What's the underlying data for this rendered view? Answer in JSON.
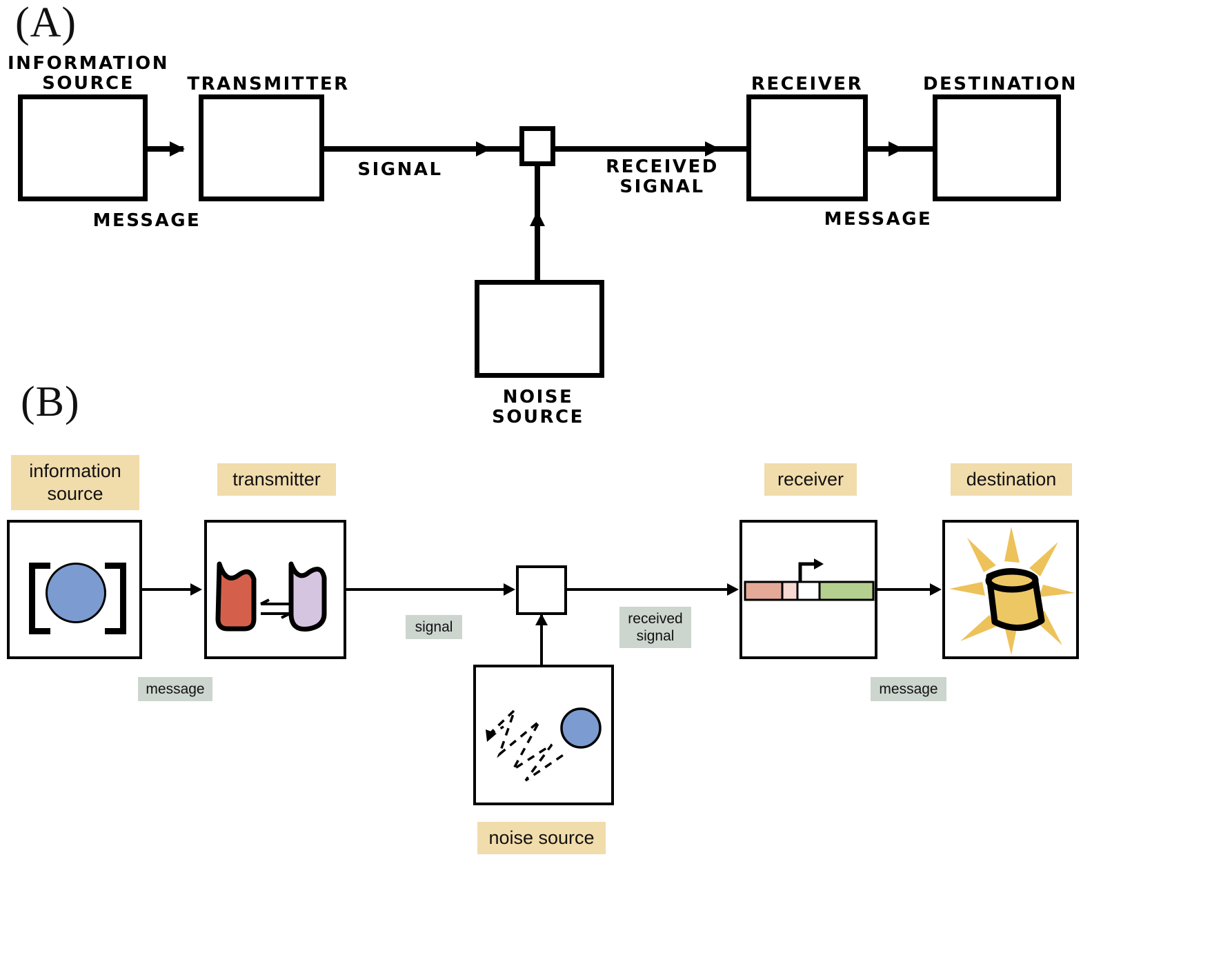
{
  "figure": {
    "panel_a_letter": "(A)",
    "panel_b_letter": "(B)"
  },
  "panel_a": {
    "style": "hand-drawn classic Shannon communication system diagram",
    "boxes": [
      {
        "id": "information-source",
        "label": "INFORMATION\nSOURCE"
      },
      {
        "id": "transmitter",
        "label": "TRANSMITTER"
      },
      {
        "id": "channel-junction",
        "label": ""
      },
      {
        "id": "receiver",
        "label": "RECEIVER"
      },
      {
        "id": "destination",
        "label": "DESTINATION"
      },
      {
        "id": "noise-source",
        "label": "NOISE\nSOURCE"
      }
    ],
    "flow_labels": [
      {
        "id": "message-left",
        "label": "MESSAGE"
      },
      {
        "id": "signal",
        "label": "SIGNAL"
      },
      {
        "id": "received-signal",
        "label": "RECEIVED\nSIGNAL"
      },
      {
        "id": "message-right",
        "label": "MESSAGE"
      }
    ]
  },
  "panel_b": {
    "style": "biological / synthetic-biology analogue of the Shannon model",
    "boxes": [
      {
        "id": "information-source",
        "tag": "information\nsource",
        "content": "blue circle inside square brackets (inducer molecule concentration)"
      },
      {
        "id": "transmitter",
        "tag": "transmitter",
        "content": "red enzyme and purple enzyme linked by reversible reaction arrows"
      },
      {
        "id": "channel-junction",
        "tag": "",
        "content": "empty small square (channel mixing point)"
      },
      {
        "id": "receiver",
        "tag": "receiver",
        "content": "gene construct: salmon, pink, white and green segments with bent promoter arrow"
      },
      {
        "id": "destination",
        "tag": "destination",
        "content": "glowing yellow fluorescent protein barrel"
      },
      {
        "id": "noise-source",
        "tag": "noise source",
        "content": "dashed random-walk trajectory with blue circle"
      }
    ],
    "flow_labels": [
      {
        "id": "message-left",
        "label": "message"
      },
      {
        "id": "signal",
        "label": "signal"
      },
      {
        "id": "received-signal",
        "label": "received\nsignal"
      },
      {
        "id": "message-right",
        "label": "message"
      }
    ],
    "colors": {
      "tag_background": "#f1dcab",
      "flow_background": "#ccd5ce",
      "inducer_blue": "#7b9bd1",
      "enzyme_red": "#d4604c",
      "enzyme_purple": "#d6c5e0",
      "gene_salmon": "#e5a998",
      "gene_pink": "#f5d9d2",
      "gene_white": "#ffffff",
      "gene_green": "#b5cf8e",
      "reporter_yellow": "#eec765",
      "glow_yellow": "#edc25a",
      "outline_black": "#000000"
    }
  }
}
